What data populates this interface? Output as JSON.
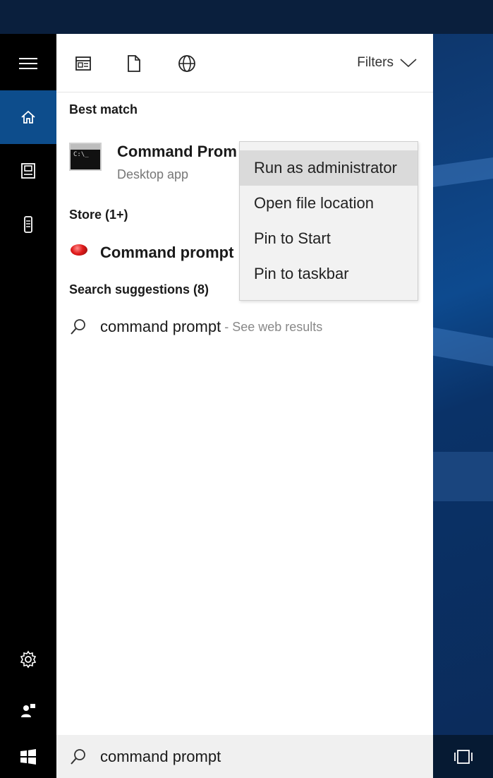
{
  "toolbar": {
    "filters_label": "Filters"
  },
  "results": {
    "best_match_heading": "Best match",
    "best_match_title": "Command Prom",
    "best_match_subtitle": "Desktop app",
    "best_match_icon_text": "C:\\_",
    "store_heading": "Store (1+)",
    "store_item": "Command prompt",
    "suggestions_heading": "Search suggestions (8)",
    "suggestion_query": "command prompt",
    "suggestion_separator": " - ",
    "suggestion_hint": "See web results"
  },
  "context_menu": {
    "items": [
      {
        "label": "Run as administrator"
      },
      {
        "label": "Open file location"
      },
      {
        "label": "Pin to Start"
      },
      {
        "label": "Pin to taskbar"
      }
    ]
  },
  "search": {
    "value": "command prompt"
  },
  "colors": {
    "rail_active": "#0d4d8c",
    "rail_bg": "#000000",
    "panel_bg": "#ffffff",
    "menu_bg": "#f2f2f2",
    "menu_hover": "#dadada"
  },
  "icons": {
    "rail": [
      "hamburger-menu-icon",
      "home-icon",
      "notebook-icon",
      "device-icon",
      "settings-icon",
      "feedback-icon",
      "windows-start-icon"
    ],
    "toolbar": [
      "apps-filter-icon",
      "documents-filter-icon",
      "web-filter-icon",
      "chevron-down-icon"
    ],
    "taskbar": [
      "task-view-icon"
    ]
  }
}
